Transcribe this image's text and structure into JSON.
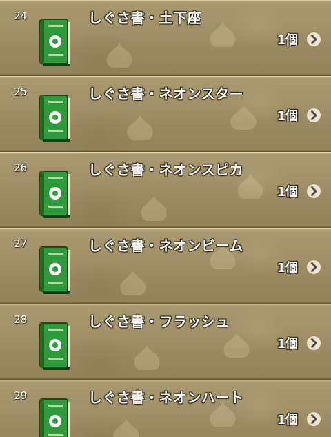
{
  "items": [
    {
      "number": "24",
      "name": "しぐさ書・土下座",
      "count": "1個",
      "icon": "green-book-icon"
    },
    {
      "number": "25",
      "name": "しぐさ書・ネオンスター",
      "count": "1個",
      "icon": "green-book-icon"
    },
    {
      "number": "26",
      "name": "しぐさ書・ネオンスピカ",
      "count": "1個",
      "icon": "green-book-icon"
    },
    {
      "number": "27",
      "name": "しぐさ書・ネオンビーム",
      "count": "1個",
      "icon": "green-book-icon"
    },
    {
      "number": "28",
      "name": "しぐさ書・フラッシュ",
      "count": "1個",
      "icon": "green-book-icon"
    },
    {
      "number": "29",
      "name": "しぐさ書・ネオンハート",
      "count": "1個",
      "icon": "green-book-icon"
    }
  ],
  "colors": {
    "book_green": "#2e9a3c",
    "book_dark": "#1d6a27",
    "chevron_bg": "#ece4cf",
    "chevron_arrow": "#4a4a4a",
    "panel_bg": "#a3926a"
  },
  "chevron_icon": "chevron-right-icon"
}
